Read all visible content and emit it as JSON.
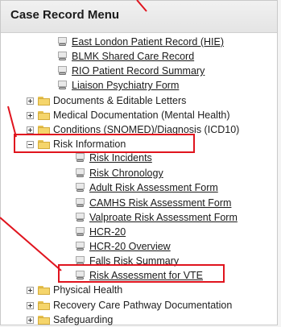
{
  "menu": {
    "title": "Case Record Menu",
    "items": [
      {
        "label": "East London Patient Record (HIE)",
        "kind": "link"
      },
      {
        "label": "BLMK Shared Care Record",
        "kind": "link"
      },
      {
        "label": "RIO Patient Record Summary",
        "kind": "link"
      },
      {
        "label": "Liaison Psychiatry Form",
        "kind": "link"
      },
      {
        "label": "Documents & Editable Letters",
        "kind": "folder",
        "state": "collapsed"
      },
      {
        "label": "Medical Documentation (Mental Health)",
        "kind": "folder",
        "state": "collapsed"
      },
      {
        "label": "Conditions (SNOMED)/Diagnosis (ICD10)",
        "kind": "folder",
        "state": "collapsed"
      },
      {
        "label": "Risk Information",
        "kind": "folder",
        "state": "expanded",
        "highlighted": true
      },
      {
        "label": "Risk Incidents",
        "kind": "link"
      },
      {
        "label": "Risk Chronology",
        "kind": "link"
      },
      {
        "label": "Adult Risk Assessment Form",
        "kind": "link"
      },
      {
        "label": "CAMHS Risk Assessment Form",
        "kind": "link"
      },
      {
        "label": "Valproate Risk Assessment Form",
        "kind": "link"
      },
      {
        "label": "HCR-20",
        "kind": "link"
      },
      {
        "label": "HCR-20 Overview",
        "kind": "link"
      },
      {
        "label": "Falls Risk Summary",
        "kind": "link"
      },
      {
        "label": "Risk Assessment for VTE",
        "kind": "link",
        "highlighted": true
      },
      {
        "label": "Physical Health",
        "kind": "folder",
        "state": "collapsed"
      },
      {
        "label": "Recovery Care Pathway Documentation",
        "kind": "folder",
        "state": "collapsed"
      },
      {
        "label": "Safeguarding",
        "kind": "folder",
        "state": "collapsed"
      }
    ]
  },
  "colors": {
    "annotation": "#e0141e",
    "folder": "#f5d56b",
    "header_bg": "#e9e9e9"
  }
}
